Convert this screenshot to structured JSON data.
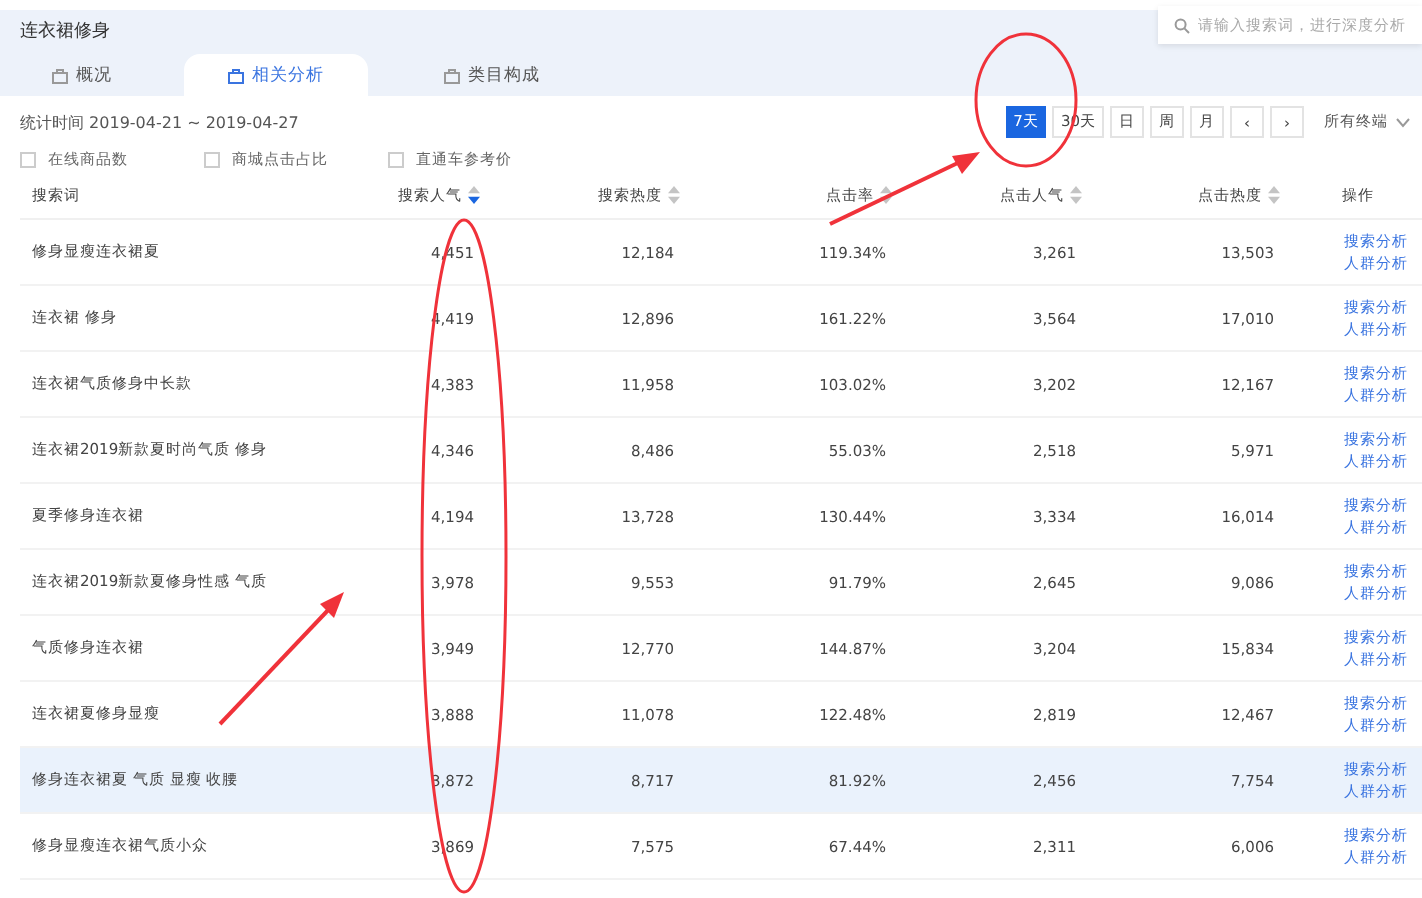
{
  "header": {
    "title": "连衣裙修身",
    "search": {
      "placeholder": "请输入搜索词，进行深度分析"
    }
  },
  "tabs": [
    {
      "label": "概况",
      "selected": false
    },
    {
      "label": "相关分析",
      "selected": true
    },
    {
      "label": "类目构成",
      "selected": false
    }
  ],
  "date_range": "统计时间 2019-04-21 ~ 2019-04-27",
  "period_buttons": [
    {
      "label": "7天",
      "selected": true
    },
    {
      "label": "30天",
      "selected": false
    },
    {
      "label": "日",
      "selected": false
    },
    {
      "label": "周",
      "selected": false
    },
    {
      "label": "月",
      "selected": false
    },
    {
      "label": "‹",
      "selected": false
    },
    {
      "label": "›",
      "selected": false
    }
  ],
  "device_select": "所有终端",
  "metric_options": [
    {
      "label": "在线商品数",
      "checked": false
    },
    {
      "label": "商城点击占比",
      "checked": false
    },
    {
      "label": "直通车参考价",
      "checked": false
    }
  ],
  "table": {
    "columns": [
      {
        "label": "搜索词",
        "sortable": false
      },
      {
        "label": "搜索人气",
        "sortable": true,
        "sorted": true
      },
      {
        "label": "搜索热度",
        "sortable": true,
        "sorted": false
      },
      {
        "label": "点击率",
        "sortable": true,
        "sorted": false
      },
      {
        "label": "点击人气",
        "sortable": true,
        "sorted": false
      },
      {
        "label": "点击热度",
        "sortable": true,
        "sorted": false
      },
      {
        "label": "操作",
        "sortable": false
      }
    ],
    "rows": [
      {
        "cells": [
          "修身显瘦连衣裙夏",
          "4,451",
          "12,184",
          "119.34%",
          "3,261",
          "13,503"
        ],
        "actions": [
          "搜索分析",
          "人群分析"
        ],
        "highlighted": false
      },
      {
        "cells": [
          "连衣裙 修身",
          "4,419",
          "12,896",
          "161.22%",
          "3,564",
          "17,010"
        ],
        "actions": [
          "搜索分析",
          "人群分析"
        ],
        "highlighted": false
      },
      {
        "cells": [
          "连衣裙气质修身中长款",
          "4,383",
          "11,958",
          "103.02%",
          "3,202",
          "12,167"
        ],
        "actions": [
          "搜索分析",
          "人群分析"
        ],
        "highlighted": false
      },
      {
        "cells": [
          "连衣裙2019新款夏时尚气质 修身",
          "4,346",
          "8,486",
          "55.03%",
          "2,518",
          "5,971"
        ],
        "actions": [
          "搜索分析",
          "人群分析"
        ],
        "highlighted": false
      },
      {
        "cells": [
          "夏季修身连衣裙",
          "4,194",
          "13,728",
          "130.44%",
          "3,334",
          "16,014"
        ],
        "actions": [
          "搜索分析",
          "人群分析"
        ],
        "highlighted": false
      },
      {
        "cells": [
          "连衣裙2019新款夏修身性感 气质",
          "3,978",
          "9,553",
          "91.79%",
          "2,645",
          "9,086"
        ],
        "actions": [
          "搜索分析",
          "人群分析"
        ],
        "highlighted": false
      },
      {
        "cells": [
          "气质修身连衣裙",
          "3,949",
          "12,770",
          "144.87%",
          "3,204",
          "15,834"
        ],
        "actions": [
          "搜索分析",
          "人群分析"
        ],
        "highlighted": false
      },
      {
        "cells": [
          "连衣裙夏修身显瘦",
          "3,888",
          "11,078",
          "122.48%",
          "2,819",
          "12,467"
        ],
        "actions": [
          "搜索分析",
          "人群分析"
        ],
        "highlighted": false
      },
      {
        "cells": [
          "修身连衣裙夏 气质 显瘦 收腰",
          "3,872",
          "8,717",
          "81.92%",
          "2,456",
          "7,754"
        ],
        "actions": [
          "搜索分析",
          "人群分析"
        ],
        "highlighted": true
      },
      {
        "cells": [
          "修身显瘦连衣裙气质小众",
          "3,869",
          "7,575",
          "67.44%",
          "2,311",
          "6,006"
        ],
        "actions": [
          "搜索分析",
          "人群分析"
        ],
        "highlighted": false
      }
    ]
  }
}
